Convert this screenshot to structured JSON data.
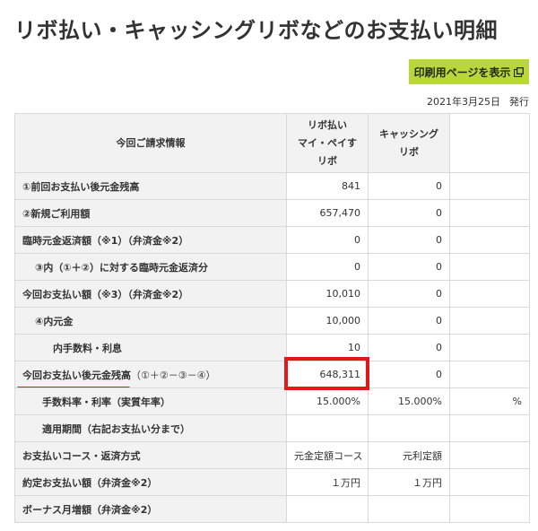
{
  "page": {
    "title": "リボ払い・キャッシングリボなどのお支払い明細",
    "print_button_label": "印刷用ページを表示",
    "issue_date": "2021年3月25日",
    "issue_label": "発行"
  },
  "table": {
    "header_label": "今回ご請求情報",
    "col1_header_line1": "リボ払い",
    "col1_header_line2": "マイ・ペイすリボ",
    "col2_header": "キャッシングリボ",
    "rows": [
      {
        "label": "①前回お支払い後元金残高",
        "col1": "841",
        "col2": "0",
        "extra": ""
      },
      {
        "label": "②新規ご利用額",
        "col1": "657,470",
        "col2": "0",
        "extra": ""
      },
      {
        "label": "臨時元金返済額（※1）（弁済金※2）",
        "col1": "0",
        "col2": "0",
        "extra": ""
      },
      {
        "label": "③内（①＋②）に対する臨時元金返済分",
        "col1": "0",
        "col2": "0",
        "extra": ""
      },
      {
        "label": "今回お支払い額（※3）（弁済金※2）",
        "col1": "10,010",
        "col2": "0",
        "extra": ""
      },
      {
        "label": "④内元金",
        "col1": "10,000",
        "col2": "0",
        "extra": ""
      },
      {
        "label": "内手数料・利息",
        "col1": "10",
        "col2": "0",
        "extra": ""
      },
      {
        "label_main": "今回お支払い後元金残高",
        "label_suffix": "（①＋②－③－④）",
        "col1": "648,311",
        "col2": "0",
        "extra": ""
      },
      {
        "label": "手数料率・利率（実質年率）",
        "col1": "15.000%",
        "col2": "15.000%",
        "extra": "%"
      },
      {
        "label": "適用期間（右記お支払い分まで）",
        "col1": "",
        "col2": "",
        "extra": ""
      },
      {
        "label": "お支払いコース・返済方式",
        "col1": "元金定額コース",
        "col2": "元利定額",
        "extra": ""
      },
      {
        "label": "約定お支払い額（弁済金※2）",
        "col1": "１万円",
        "col2": "１万円",
        "extra": ""
      },
      {
        "label": "ボーナス月増額（弁済金※2）",
        "col1": "",
        "col2": "",
        "extra": ""
      }
    ]
  },
  "colors": {
    "accent_button": "#b9d63a",
    "highlight_red": "#e01818",
    "label_bg": "#f2f2f2"
  }
}
